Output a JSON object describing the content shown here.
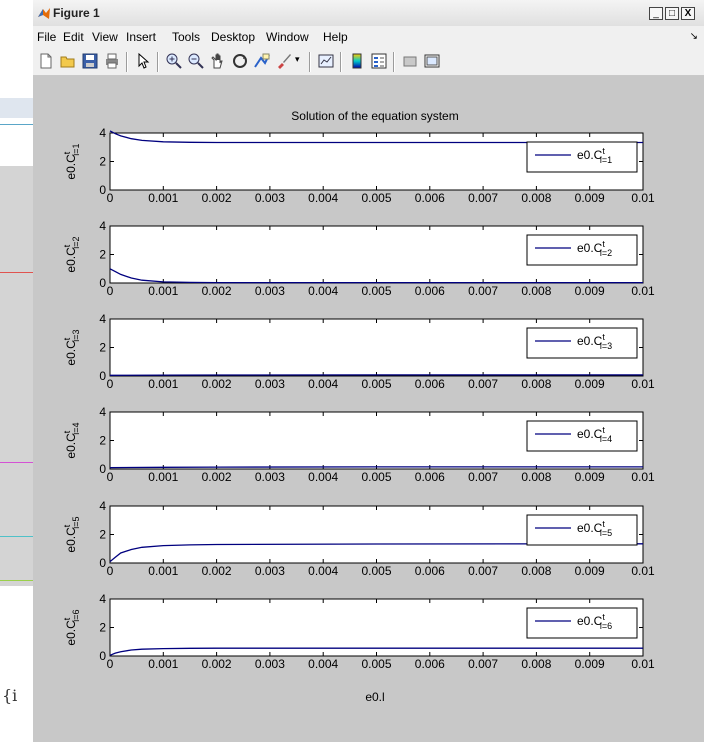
{
  "window": {
    "title": "Figure 1",
    "controls": [
      "_",
      "□",
      "X"
    ],
    "dock_arrow": "↘"
  },
  "menu": [
    "File",
    "Edit",
    "View",
    "Insert",
    "Tools",
    "Desktop",
    "Window",
    "Help"
  ],
  "toolbar_icons": [
    "new-figure-icon",
    "open-icon",
    "save-icon",
    "print-icon",
    "pointer-icon",
    "zoom-in-icon",
    "zoom-out-icon",
    "pan-icon",
    "rotate-3d-icon",
    "data-cursor-icon",
    "brush-icon",
    "link-plot-icon",
    "colorbar-icon",
    "legend-icon",
    "hide-plot-tools-icon",
    "show-plot-tools-icon"
  ],
  "background_app": {
    "partial_text": "{i"
  },
  "chart_data": {
    "type": "line",
    "title": "Solution of the equation system",
    "xlabel": "e0.l",
    "xlim": [
      0,
      0.01
    ],
    "ylim": [
      0,
      4
    ],
    "x_ticks": [
      "0",
      "0.001",
      "0.002",
      "0.003",
      "0.004",
      "0.005",
      "0.006",
      "0.007",
      "0.008",
      "0.009",
      "0.01"
    ],
    "y_ticks": [
      "0",
      "2",
      "4"
    ],
    "line_color": "#00007f",
    "subplots": [
      {
        "ylabel_main": "e0.C",
        "ylabel_sup": "t",
        "ylabel_sub": "i=1",
        "legend": {
          "main": "e0.C",
          "sup": "t",
          "sub": "i=1"
        },
        "x": [
          0,
          0.0001,
          0.0002,
          0.0004,
          0.0006,
          0.001,
          0.0015,
          0.002,
          0.005,
          0.01
        ],
        "y": [
          4.15,
          3.95,
          3.8,
          3.6,
          3.48,
          3.38,
          3.35,
          3.33,
          3.33,
          3.33
        ]
      },
      {
        "ylabel_main": "e0.C",
        "ylabel_sup": "t",
        "ylabel_sub": "i=2",
        "legend": {
          "main": "e0.C",
          "sup": "t",
          "sub": "i=2"
        },
        "x": [
          0,
          0.0001,
          0.0002,
          0.0004,
          0.0006,
          0.001,
          0.0015,
          0.002,
          0.005,
          0.01
        ],
        "y": [
          1.0,
          0.8,
          0.6,
          0.35,
          0.2,
          0.08,
          0.04,
          0.03,
          0.03,
          0.03
        ]
      },
      {
        "ylabel_main": "e0.C",
        "ylabel_sup": "t",
        "ylabel_sub": "i=3",
        "legend": {
          "main": "e0.C",
          "sup": "t",
          "sub": "i=3"
        },
        "x": [
          0,
          0.001,
          0.002,
          0.005,
          0.01
        ],
        "y": [
          0.05,
          0.06,
          0.07,
          0.08,
          0.08
        ]
      },
      {
        "ylabel_main": "e0.C",
        "ylabel_sup": "t",
        "ylabel_sub": "i=4",
        "legend": {
          "main": "e0.C",
          "sup": "t",
          "sub": "i=4"
        },
        "x": [
          0,
          0.001,
          0.002,
          0.005,
          0.01
        ],
        "y": [
          0.1,
          0.12,
          0.13,
          0.15,
          0.15
        ]
      },
      {
        "ylabel_main": "e0.C",
        "ylabel_sup": "t",
        "ylabel_sub": "i=5",
        "legend": {
          "main": "e0.C",
          "sup": "t",
          "sub": "i=5"
        },
        "x": [
          0,
          0.0001,
          0.0002,
          0.0004,
          0.0006,
          0.001,
          0.0015,
          0.002,
          0.005,
          0.01
        ],
        "y": [
          0.1,
          0.4,
          0.7,
          0.95,
          1.1,
          1.22,
          1.27,
          1.3,
          1.33,
          1.35
        ]
      },
      {
        "ylabel_main": "e0.C",
        "ylabel_sup": "t",
        "ylabel_sub": "i=6",
        "legend": {
          "main": "e0.C",
          "sup": "t",
          "sub": "i=6"
        },
        "x": [
          0,
          0.0001,
          0.0002,
          0.0004,
          0.0006,
          0.001,
          0.0015,
          0.002,
          0.005,
          0.01
        ],
        "y": [
          0.05,
          0.2,
          0.3,
          0.42,
          0.48,
          0.52,
          0.54,
          0.55,
          0.55,
          0.55
        ]
      }
    ]
  }
}
